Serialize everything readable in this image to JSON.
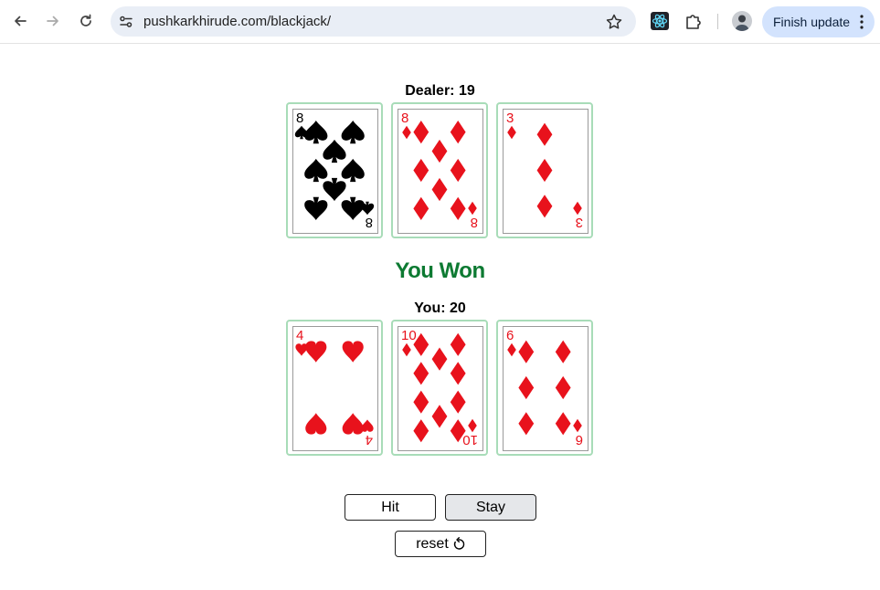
{
  "browser": {
    "url": "pushkarkhirude.com/blackjack/",
    "update_label": "Finish update"
  },
  "dealer": {
    "score_label": "Dealer: 19",
    "cards": [
      {
        "rank": "8",
        "suit": "spades"
      },
      {
        "rank": "8",
        "suit": "diamonds"
      },
      {
        "rank": "3",
        "suit": "diamonds"
      }
    ]
  },
  "result": "You Won",
  "player": {
    "score_label": "You: 20",
    "cards": [
      {
        "rank": "4",
        "suit": "hearts"
      },
      {
        "rank": "10",
        "suit": "diamonds"
      },
      {
        "rank": "6",
        "suit": "diamonds"
      }
    ]
  },
  "controls": {
    "hit_label": "Hit",
    "stay_label": "Stay",
    "reset_label": "reset"
  },
  "colors": {
    "red_suit": "#e8121c",
    "black_suit": "#000000",
    "result_text": "#0d7a32",
    "card_border": "#a8dcb8"
  },
  "icons": {
    "reset": "rotate-ccw-icon"
  }
}
